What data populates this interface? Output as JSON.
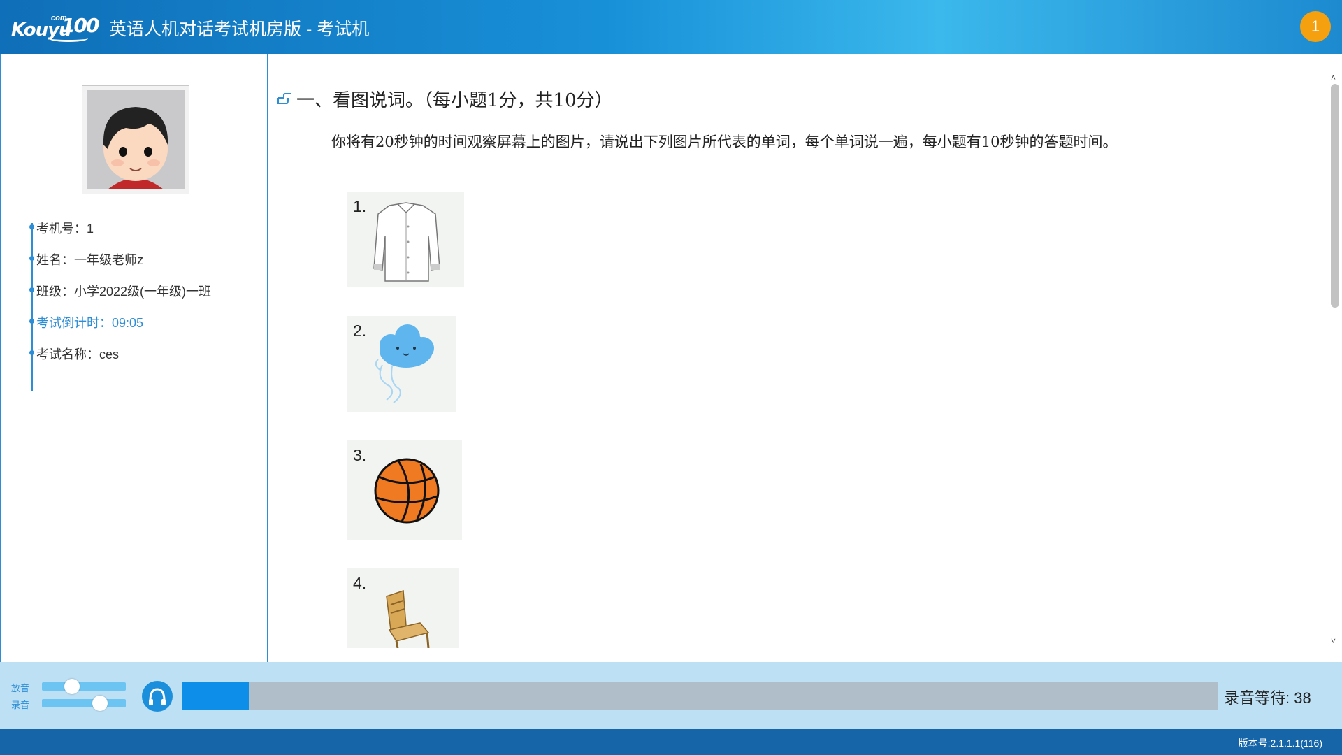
{
  "header": {
    "logo_word": "Kouyu",
    "logo_com": "com",
    "logo_num": "100",
    "title": "英语人机对话考试机房版 - 考试机",
    "badge": "1"
  },
  "student": {
    "exam_no": "考机号：1",
    "name": "姓名：一年级老师z",
    "class": "班级：小学2022级(一年级)一班",
    "countdown": "考试倒计时：09:05",
    "exam_name": "考试名称：ces"
  },
  "content": {
    "section_title": "一、看图说词。（每小题1分，共10分）",
    "instructions": "你将有20秒钟的时间观察屏幕上的图片，请说出下列图片所代表的单词，每个单词说一遍，每小题有10秒钟的答题时间。",
    "pictures": [
      {
        "num": "1.",
        "icon": "shirt-icon"
      },
      {
        "num": "2.",
        "icon": "windy-cloud-icon"
      },
      {
        "num": "3.",
        "icon": "basketball-icon"
      },
      {
        "num": "4.",
        "icon": "chair-icon"
      }
    ]
  },
  "audio": {
    "playback_label": "放音",
    "record_label": "录音",
    "playback_level": 0.33,
    "record_level": 0.73,
    "progress": 0.065,
    "record_wait": "录音等待: 38",
    "accent": "#0c8ee9"
  },
  "footer": {
    "version": "版本号:2.1.1.1(116)"
  }
}
